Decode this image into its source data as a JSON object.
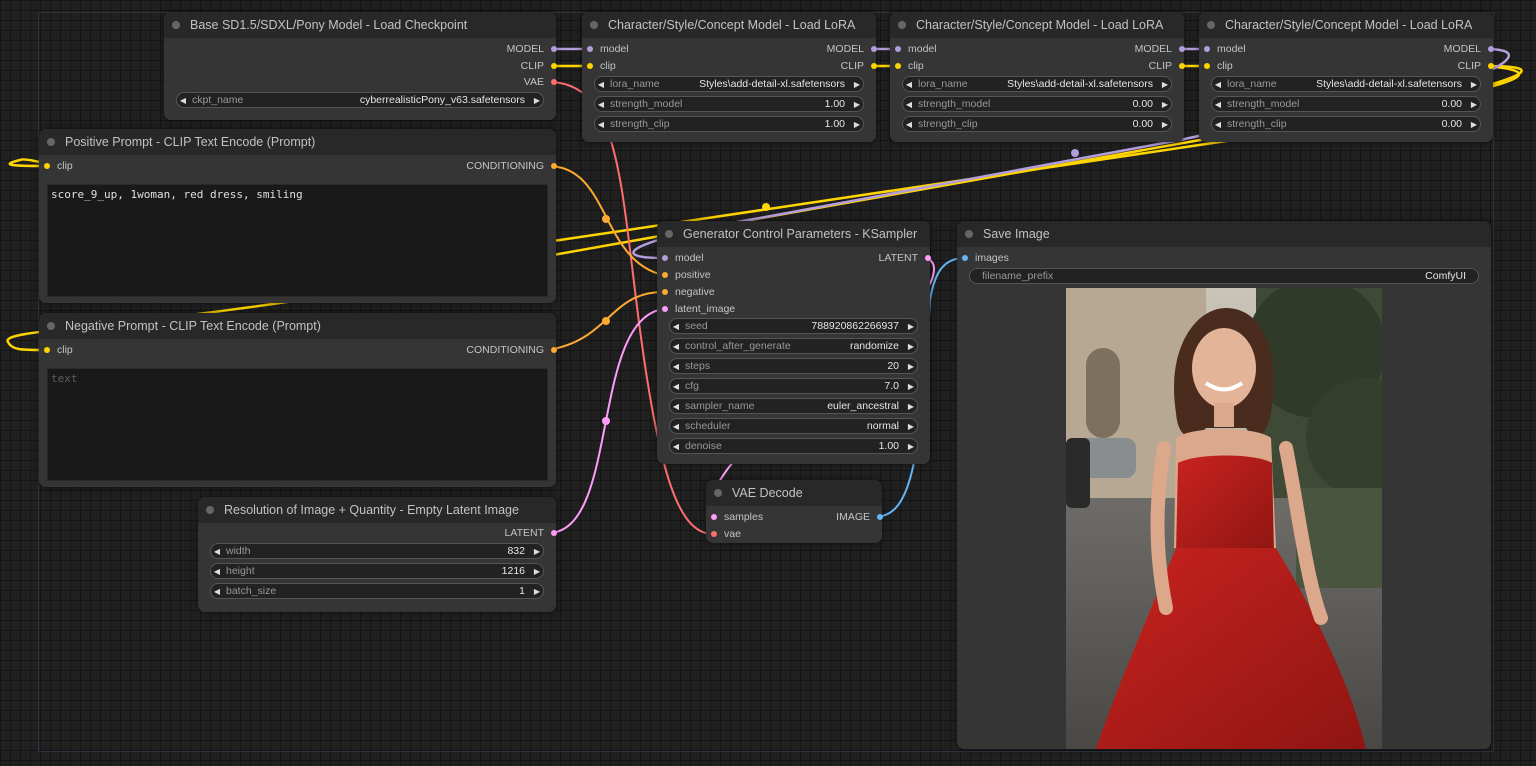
{
  "colors": {
    "model": "#b39ddb",
    "clip": "#ffd500",
    "vae": "#ff6e6e",
    "conditioning": "#ffa931",
    "latent": "#ff9cf9",
    "image": "#64b5f6"
  },
  "checkpoint": {
    "title": "Base SD1.5/SDXL/Pony Model - Load Checkpoint",
    "out_model": "MODEL",
    "out_clip": "CLIP",
    "out_vae": "VAE",
    "ckpt_label": "ckpt_name",
    "ckpt_value": "cyberrealisticPony_v63.safetensors"
  },
  "loras": [
    {
      "title": "Character/Style/Concept Model - Load LoRA",
      "in_model": "model",
      "in_clip": "clip",
      "out_model": "MODEL",
      "out_clip": "CLIP",
      "lora_label": "lora_name",
      "lora_value": "Styles\\add-detail-xl.safetensors",
      "sm_label": "strength_model",
      "sm_value": "1.00",
      "sc_label": "strength_clip",
      "sc_value": "1.00"
    },
    {
      "title": "Character/Style/Concept Model - Load LoRA",
      "in_model": "model",
      "in_clip": "clip",
      "out_model": "MODEL",
      "out_clip": "CLIP",
      "lora_label": "lora_name",
      "lora_value": "Styles\\add-detail-xl.safetensors",
      "sm_label": "strength_model",
      "sm_value": "0.00",
      "sc_label": "strength_clip",
      "sc_value": "0.00"
    },
    {
      "title": "Character/Style/Concept Model - Load LoRA",
      "in_model": "model",
      "in_clip": "clip",
      "out_model": "MODEL",
      "out_clip": "CLIP",
      "lora_label": "lora_name",
      "lora_value": "Styles\\add-detail-xl.safetensors",
      "sm_label": "strength_model",
      "sm_value": "0.00",
      "sc_label": "strength_clip",
      "sc_value": "0.00"
    }
  ],
  "positive": {
    "title": "Positive Prompt - CLIP Text Encode (Prompt)",
    "in_clip": "clip",
    "out": "CONDITIONING",
    "text": "score_9_up, 1woman, red dress, smiling"
  },
  "negative": {
    "title": "Negative Prompt - CLIP Text Encode (Prompt)",
    "in_clip": "clip",
    "out": "CONDITIONING",
    "placeholder": "text"
  },
  "latent": {
    "title": "Resolution of Image + Quantity - Empty Latent Image",
    "out": "LATENT",
    "width_label": "width",
    "width_value": "832",
    "height_label": "height",
    "height_value": "1216",
    "batch_label": "batch_size",
    "batch_value": "1"
  },
  "ksampler": {
    "title": "Generator Control Parameters - KSampler",
    "in_model": "model",
    "in_positive": "positive",
    "in_negative": "negative",
    "in_latent": "latent_image",
    "out": "LATENT",
    "seed_label": "seed",
    "seed_value": "788920862266937",
    "cag_label": "control_after_generate",
    "cag_value": "randomize",
    "steps_label": "steps",
    "steps_value": "20",
    "cfg_label": "cfg",
    "cfg_value": "7.0",
    "sampler_label": "sampler_name",
    "sampler_value": "euler_ancestral",
    "scheduler_label": "scheduler",
    "scheduler_value": "normal",
    "denoise_label": "denoise",
    "denoise_value": "1.00"
  },
  "vae_decode": {
    "title": "VAE Decode",
    "in_samples": "samples",
    "in_vae": "vae",
    "out": "IMAGE"
  },
  "save_image": {
    "title": "Save Image",
    "in_images": "images",
    "prefix_label": "filename_prefix",
    "prefix_value": "ComfyUI"
  }
}
